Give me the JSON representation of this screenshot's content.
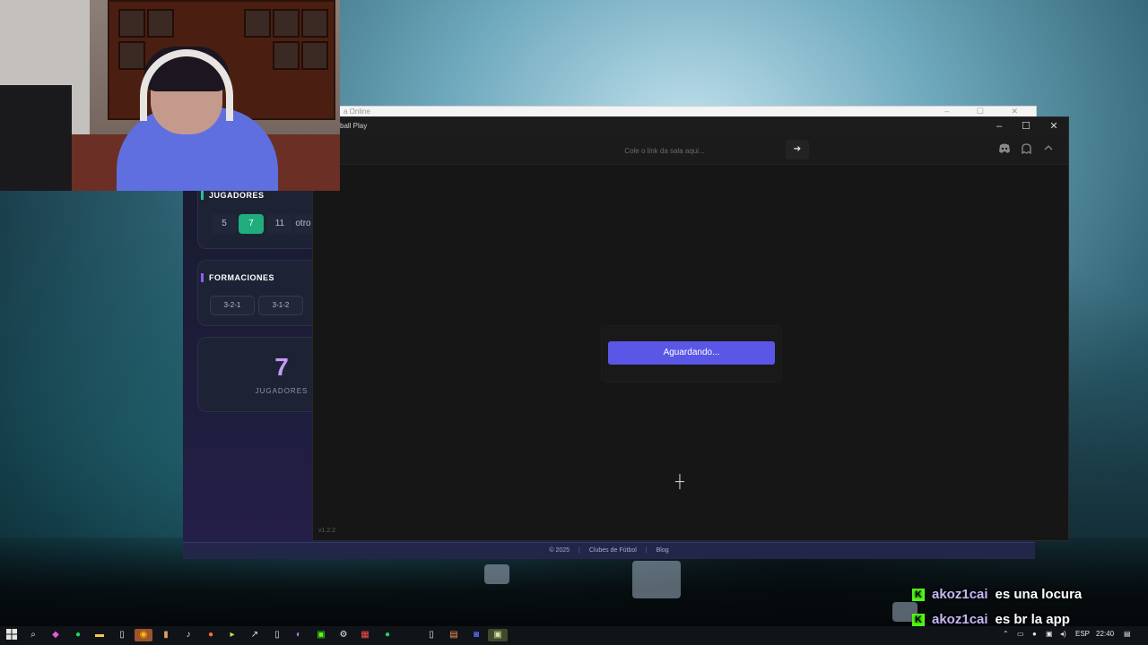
{
  "background_window": {
    "title": "a Online",
    "controls": "–  ☐  ✕"
  },
  "webapp": {
    "players_section": {
      "title": "JUGADORES",
      "options": [
        "5",
        "7",
        "11",
        "otro"
      ],
      "active": "7"
    },
    "formations_section": {
      "title": "FORMACIONES",
      "options": [
        "3-2-1",
        "3-1-2"
      ]
    },
    "summary": {
      "number": "7",
      "label": "JUGADORES"
    },
    "footer": {
      "copyright": "© 2025",
      "link1": "Clubes de Fútbol",
      "link2": "Blog"
    }
  },
  "app_window": {
    "title": "ball Play",
    "controls": {
      "minimize": "–",
      "maximize": "☐",
      "close": "✕"
    },
    "url_input": {
      "placeholder": "Cole o link da sala aqui...",
      "value": ""
    },
    "go_icon": "arrow-right-icon",
    "toolbar_icons": [
      "discord-icon",
      "ghost-icon",
      "chevron-up-icon"
    ],
    "status_button": "Aguardando...",
    "version": "v1.2.2"
  },
  "chat": [
    {
      "badge": "K",
      "user": "akoz1cai",
      "message": "es una locura"
    },
    {
      "badge": "K",
      "user": "akoz1cai",
      "message": "es br la app"
    }
  ],
  "taskbar": {
    "language": "ESP",
    "time": "22:40"
  },
  "colors": {
    "accent_button": "#5a57e6",
    "active_player_count": "#1fae7b",
    "kick_green": "#53fc18",
    "big_number": "#c69af7"
  }
}
